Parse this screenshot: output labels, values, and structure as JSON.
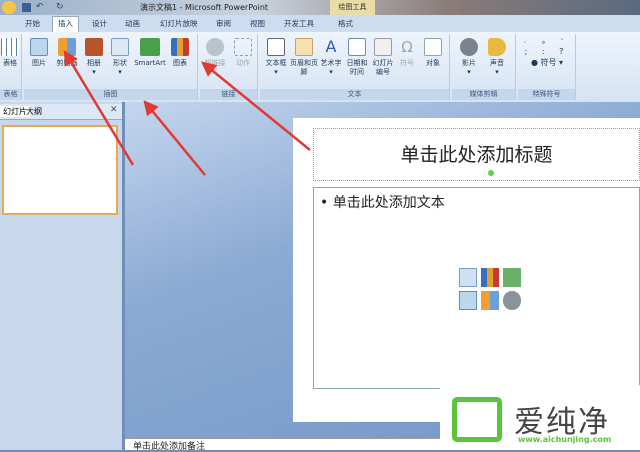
{
  "window": {
    "title": "演示文稿1 - Microsoft PowerPoint",
    "context_tool": "绘图工具"
  },
  "tabs": [
    "开始",
    "插入",
    "设计",
    "动画",
    "幻灯片放映",
    "审阅",
    "视图",
    "开发工具",
    "格式"
  ],
  "groups": {
    "table": "表格",
    "illustrations": "插图",
    "links": "链接",
    "text": "文本",
    "media": "媒体剪辑",
    "symbols": "特殊符号"
  },
  "buttons": {
    "table": "表格",
    "picture": "图片",
    "clipart": "剪贴画",
    "album": "相册",
    "shapes": "形状",
    "smartart": "SmartArt",
    "chart": "图表",
    "hyperlink": "超链接",
    "action": "动作",
    "textbox": "文本框",
    "header_footer": "页眉和页脚",
    "wordart": "艺术字",
    "datetime": "日期和时间",
    "slide_number": "幻灯片编号",
    "symbol": "符号",
    "object": "对象",
    "movie": "影片",
    "sound": "声音",
    "special_symbol": "符号"
  },
  "left_panel": {
    "tab_slides": "幻灯片",
    "tab_outline": "大纲",
    "close": "✕"
  },
  "slide": {
    "title_placeholder": "单击此处添加标题",
    "body_placeholder": "单击此处添加文本"
  },
  "notes": "单击此处添加备注",
  "watermark": {
    "name": "爱纯净",
    "url": "www.aichunjing.com"
  },
  "colors": {
    "arrow": "#e03a32",
    "logo_green": "#5ac43c"
  }
}
